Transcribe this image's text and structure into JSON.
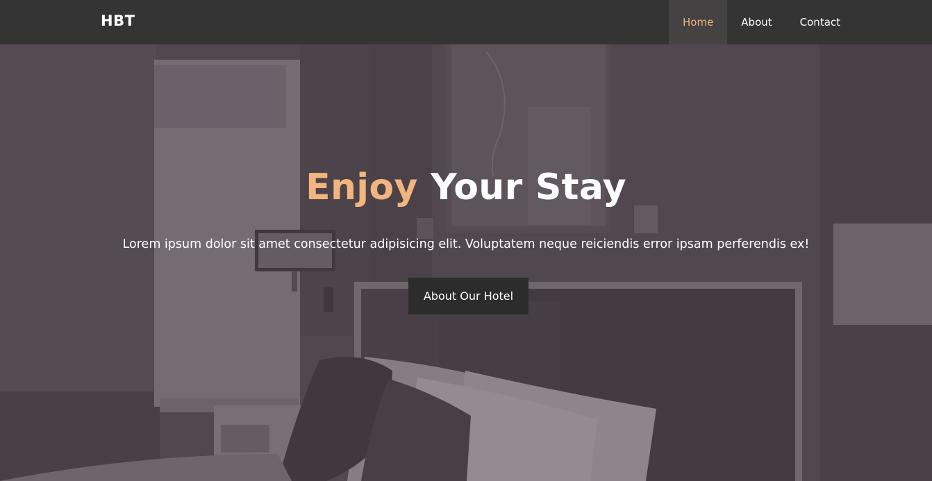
{
  "navbar": {
    "brand": "HBT",
    "links": [
      {
        "label": "Home",
        "active": true
      },
      {
        "label": "About",
        "active": false
      },
      {
        "label": "Contact",
        "active": false
      }
    ]
  },
  "hero": {
    "title_accent": "Enjoy",
    "title_rest": "Your Stay",
    "text": "Lorem ipsum dolor sit amet consectetur adipisicing elit. Voluptatem neque reiciendis error ipsam perferendis ex!",
    "button_label": "About Our Hotel"
  },
  "colors": {
    "navbar_bg": "#343434",
    "accent": "#f2b57f",
    "button_bg": "#2c2c2c",
    "overlay": "#463a42"
  }
}
